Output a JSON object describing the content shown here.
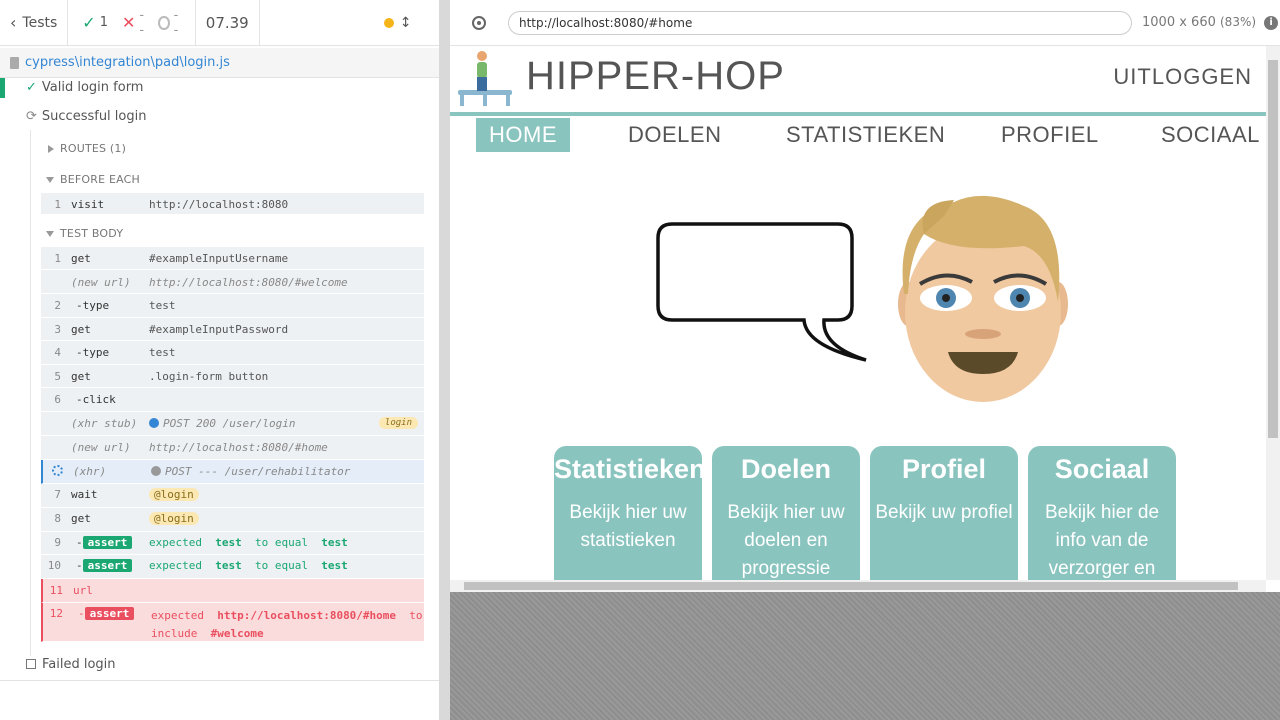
{
  "reporter": {
    "tests_label": "Tests",
    "stats": {
      "passed": "1",
      "failed": "--",
      "pending": "--",
      "duration": "07.39"
    },
    "spec_path": "cypress\\integration\\pad\\login.js",
    "tests": [
      {
        "title": "Valid login form",
        "state": "passed"
      },
      {
        "title": "Successful login",
        "state": "running"
      },
      {
        "title": "Failed login",
        "state": "pending"
      }
    ],
    "routes_label": "ROUTES (1)",
    "before_each_label": "BEFORE EACH",
    "test_body_label": "TEST BODY",
    "before_each": [
      {
        "num": "1",
        "name": "visit",
        "message": "http://localhost:8080"
      }
    ],
    "commands": [
      {
        "num": "1",
        "name": "get",
        "message": "#exampleInputUsername"
      },
      {
        "num": "",
        "name": "(new url)",
        "message": "http://localhost:8080/#welcome"
      },
      {
        "num": "2",
        "name": "-type",
        "message": "test"
      },
      {
        "num": "3",
        "name": "get",
        "message": "#exampleInputPassword"
      },
      {
        "num": "4",
        "name": "-type",
        "message": "test"
      },
      {
        "num": "5",
        "name": "get",
        "message": ".login-form button"
      },
      {
        "num": "6",
        "name": "-click",
        "message": ""
      },
      {
        "num": "",
        "name": "(xhr stub)",
        "message": "POST 200 /user/login",
        "alias": "login"
      },
      {
        "num": "",
        "name": "(new url)",
        "message": "http://localhost:8080/#home"
      },
      {
        "num": "",
        "name": "(xhr)",
        "message": "POST --- /user/rehabilitator"
      },
      {
        "num": "7",
        "name": "wait",
        "message": "@login"
      },
      {
        "num": "8",
        "name": "get",
        "message": "@login"
      },
      {
        "num": "9",
        "name": "-",
        "badge": "assert",
        "msg_a": "expected",
        "msg_b": "test",
        "msg_c": "to equal",
        "msg_d": "test"
      },
      {
        "num": "10",
        "name": "-",
        "badge": "assert",
        "msg_a": "expected",
        "msg_b": "test",
        "msg_c": "to equal",
        "msg_d": "test"
      },
      {
        "num": "11",
        "name": "url",
        "message": ""
      },
      {
        "num": "12",
        "name": "-",
        "badge": "assert",
        "msg_a": "expected",
        "msg_b": "http://localhost:8080/#home",
        "msg_c": "to",
        "msg_e": "include",
        "msg_d": "#welcome"
      }
    ]
  },
  "aut": {
    "url": "http://localhost:8080/#home",
    "viewport": "1000 x 660",
    "scale": "(83%)",
    "app": {
      "brand": "HIPPER-HOP",
      "logout": "UITLOGGEN",
      "nav": [
        "HOME",
        "DOELEN",
        "STATISTIEKEN",
        "PROFIEL",
        "SOCIAAL"
      ],
      "cards": [
        {
          "title": "Statistieken",
          "body": "Bekijk hier uw statistieken"
        },
        {
          "title": "Doelen",
          "body": "Bekijk hier uw doelen en progressie"
        },
        {
          "title": "Profiel",
          "body": "Bekijk uw profiel"
        },
        {
          "title": "Sociaal",
          "body": "Bekijk hier de info van de verzorger en"
        }
      ]
    }
  },
  "colors": {
    "teal": "#8ac4bf",
    "passed": "#1ba772",
    "failed": "#e94f5f",
    "link": "#3386d4"
  }
}
